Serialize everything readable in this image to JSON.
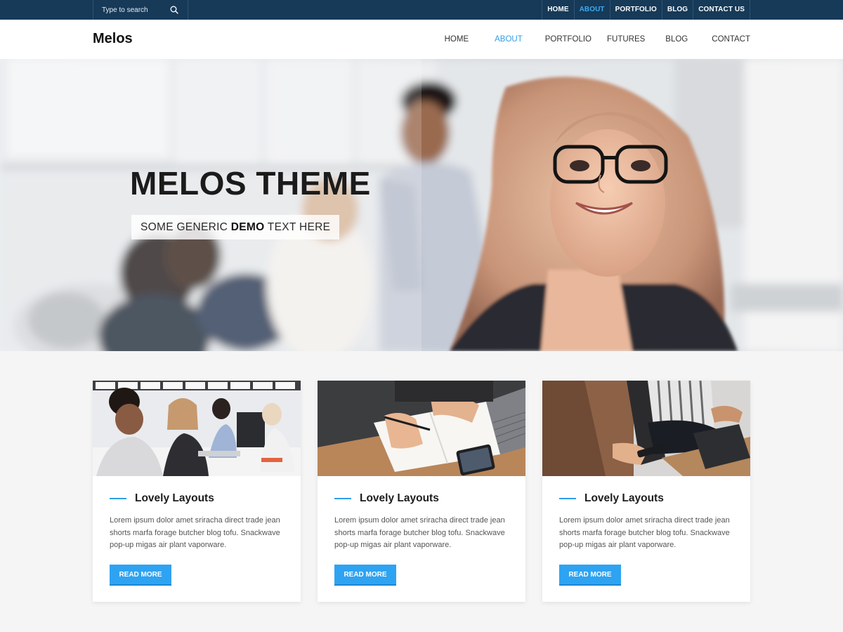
{
  "topbar": {
    "search_placeholder": "Type to search",
    "links": [
      "HOME",
      "ABOUT",
      "PORTFOLIO",
      "BLOG",
      "CONTACT US"
    ],
    "active_link": "ABOUT"
  },
  "header": {
    "logo": "Melos",
    "nav": [
      "HOME",
      "ABOUT",
      "PORTFOLIO",
      "FUTURES",
      "BLOG",
      "CONTACT"
    ],
    "active_nav": "ABOUT"
  },
  "hero": {
    "title": "MELOS THEME",
    "tagline_before": "SOME GENERIC ",
    "tagline_bold": "DEMO",
    "tagline_after": " TEXT HERE"
  },
  "cards": [
    {
      "title": "Lovely Layouts",
      "text": "Lorem ipsum dolor amet sriracha direct trade jean shorts marfa forage butcher blog tofu. Snackwave pop-up migas air plant vaporware.",
      "button": "READ MORE"
    },
    {
      "title": "Lovely Layouts",
      "text": "Lorem ipsum dolor amet sriracha direct trade jean shorts marfa forage butcher blog tofu. Snackwave pop-up migas air plant vaporware.",
      "button": "READ MORE"
    },
    {
      "title": "Lovely Layouts",
      "text": "Lorem ipsum dolor amet sriracha direct trade jean shorts marfa forage butcher blog tofu. Snackwave pop-up migas air plant vaporware.",
      "button": "READ MORE"
    }
  ],
  "colors": {
    "topbar_bg": "#163a58",
    "accent": "#2ea3f2",
    "active_link": "#3eaaf0",
    "page_bg": "#f5f5f6"
  },
  "icons": {
    "search": "search-icon"
  }
}
